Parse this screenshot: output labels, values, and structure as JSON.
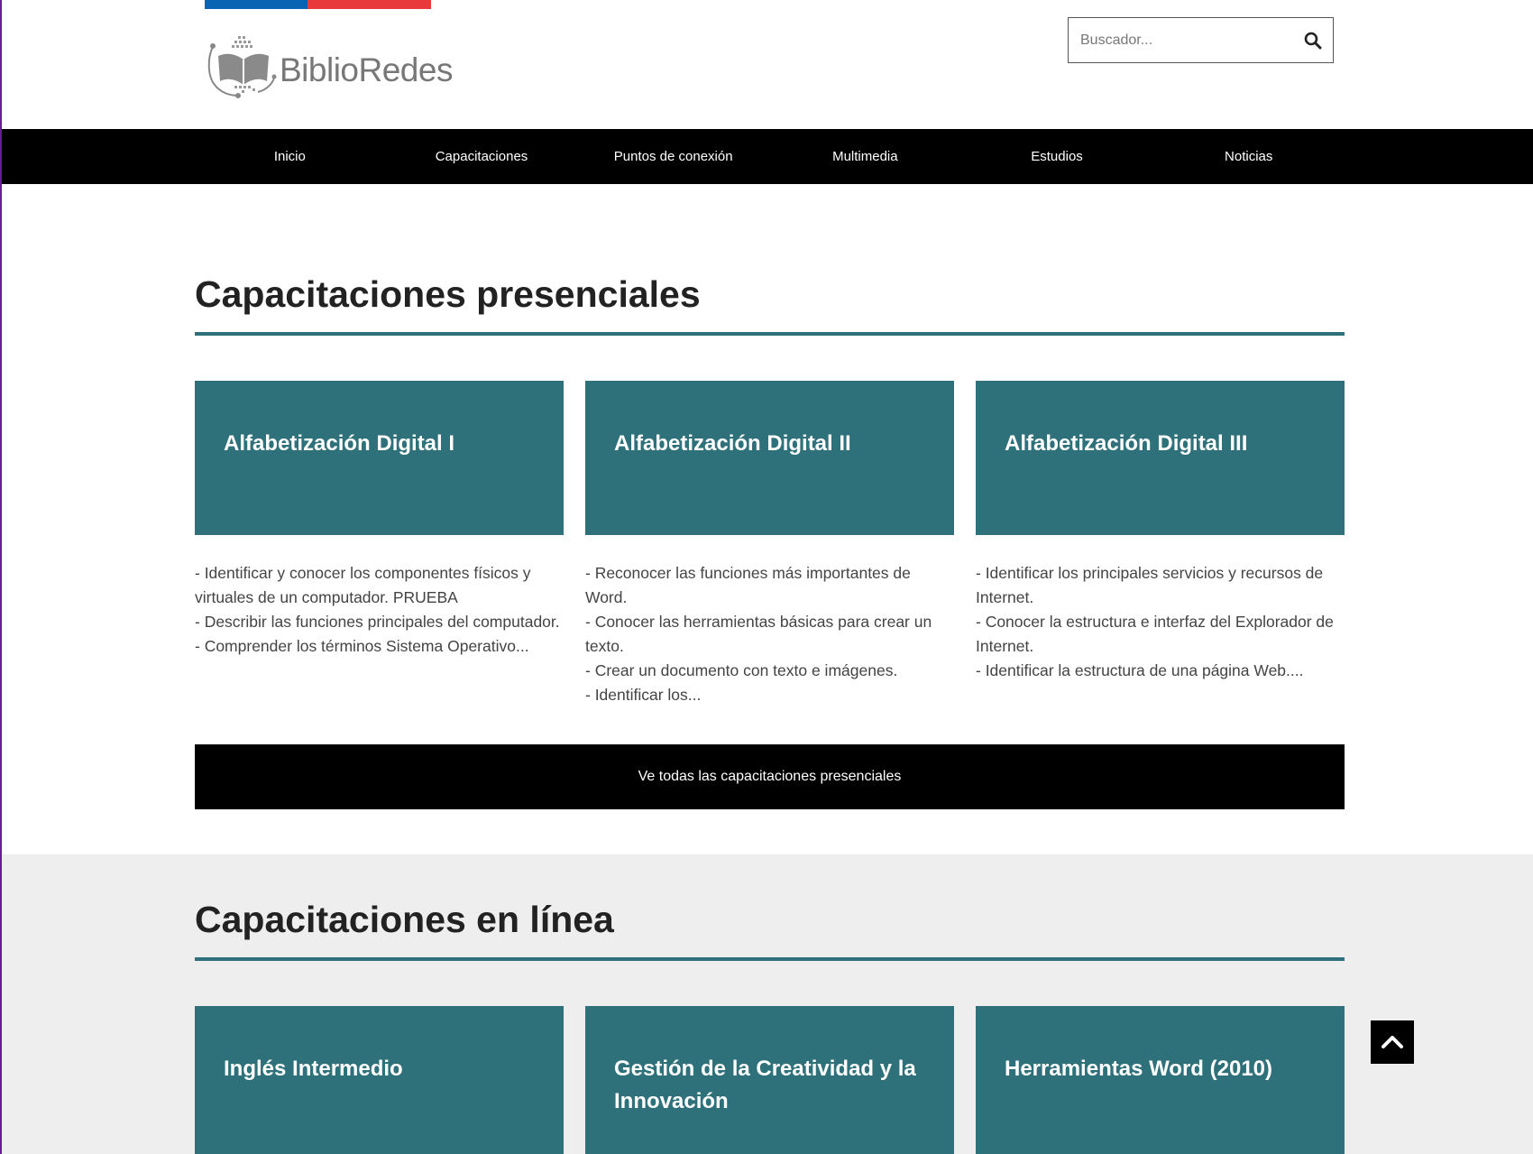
{
  "header": {
    "logo_text": "BiblioRedes",
    "search": {
      "placeholder": "Buscador..."
    },
    "colors": {
      "flag_blue": "#0a64b4",
      "flag_red": "#e83a3a"
    }
  },
  "nav": {
    "items": [
      "Inicio",
      "Capacitaciones",
      "Puntos de conexión",
      "Multimedia",
      "Estudios",
      "Noticias"
    ]
  },
  "presenciales": {
    "title": "Capacitaciones presenciales",
    "cards": [
      {
        "title": "Alfabetización Digital I",
        "lines": [
          "- Identificar y conocer los componentes físicos y virtuales de un computador. PRUEBA",
          "- Describir las funciones principales del computador.",
          "- Comprender los términos Sistema Operativo..."
        ]
      },
      {
        "title": "Alfabetización Digital II",
        "lines": [
          "- Reconocer las funciones más importantes de Word.",
          "- Conocer las herramientas básicas para crear un texto.",
          "- Crear un documento con texto e imágenes.",
          "- Identificar los..."
        ]
      },
      {
        "title": "Alfabetización Digital III",
        "lines": [
          "- Identificar los principales servicios y recursos de Internet.",
          "- Conocer la estructura e interfaz del Explorador de Internet.",
          "- Identificar la estructura de una página Web...."
        ]
      }
    ],
    "view_all_label": "Ve todas las capacitaciones presenciales"
  },
  "en_linea": {
    "title": "Capacitaciones en línea",
    "cards": [
      {
        "title": "Inglés Intermedio"
      },
      {
        "title": "Gestión de la Creatividad y la Innovación"
      },
      {
        "title": "Herramientas Word (2010)"
      }
    ]
  },
  "theme": {
    "accent": "#2e717a",
    "nav_bg": "#000000",
    "band_bg": "#eeeeee"
  },
  "icons": {
    "search": "search-icon",
    "back_to_top": "chevron-up-icon"
  }
}
